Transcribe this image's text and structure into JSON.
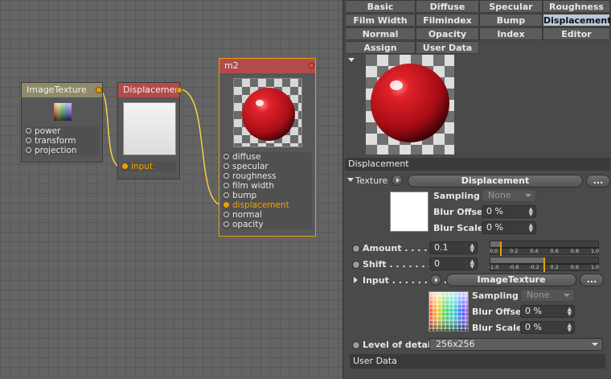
{
  "graph": {
    "nodes": {
      "image_texture": {
        "title": "ImageTexture",
        "params": [
          "power",
          "transform",
          "projection"
        ]
      },
      "displacement": {
        "title": "Displacement",
        "input": "input"
      },
      "material": {
        "title": "m2",
        "params": [
          "diffuse",
          "specular",
          "roughness",
          "film width",
          "bump",
          "displacement",
          "normal",
          "opacity"
        ],
        "active_param": "displacement"
      }
    },
    "wire_color": "#f5d23c",
    "port_color": "#e8a000"
  },
  "panel": {
    "tabs": [
      [
        "Basic",
        "Diffuse",
        "Specular",
        "Roughness"
      ],
      [
        "Film Width",
        "Filmindex",
        "Bump",
        "Displacement"
      ],
      [
        "Normal",
        "Opacity",
        "Index",
        "Editor"
      ],
      [
        "Assign",
        "User Data"
      ]
    ],
    "active_tab": "Displacement",
    "section_title": "Displacement",
    "texture": {
      "label": "Texture",
      "value": "Displacement",
      "more": "...",
      "sampling_label": "Sampling",
      "sampling_value": "None",
      "blur_offset_label": "Blur Offset",
      "blur_offset_value": "0 %",
      "blur_scale_label": "Blur Scale",
      "blur_scale_value": "0 %"
    },
    "amount": {
      "label": "Amount . . . . . .",
      "value": "0.1",
      "slider_level": 0.1,
      "ticks": [
        "0.0",
        "0.2",
        "0.4",
        "0.6",
        "0.8",
        "1.0"
      ]
    },
    "shift": {
      "label": "Shift . . . . . . . . .",
      "value": "0",
      "slider_level": 0.5,
      "ticks": [
        "-1.0",
        "-0.6",
        "-0.2",
        "0.2",
        "0.6",
        "1.0"
      ]
    },
    "input": {
      "label": "Input . . . . . . . . .",
      "value": "ImageTexture",
      "more": "...",
      "sampling_label": "Sampling",
      "sampling_value": "None",
      "blur_offset_label": "Blur Offset",
      "blur_offset_value": "0 %",
      "blur_scale_label": "Blur Scale",
      "blur_scale_value": "0 %"
    },
    "level_of_details": {
      "label": "Level of details",
      "value": "256x256"
    },
    "footer": "User Data"
  },
  "colors": {
    "accent": "#e8a000",
    "active_tab": "#b9c8dc",
    "sphere": "#c0141c"
  }
}
